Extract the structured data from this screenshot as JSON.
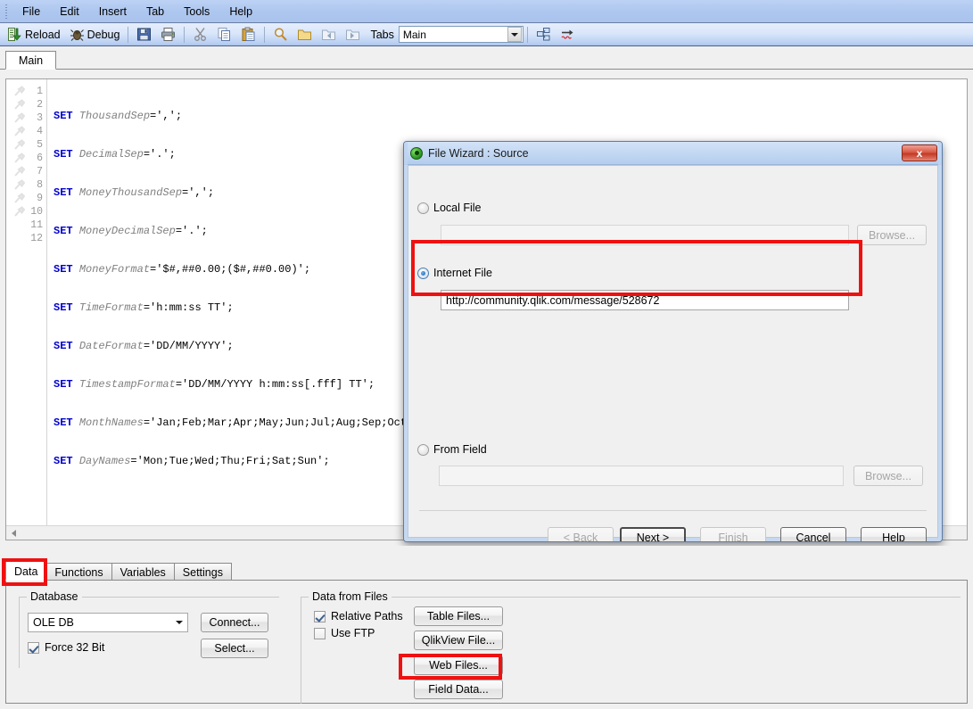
{
  "menubar": {
    "items": [
      "File",
      "Edit",
      "Insert",
      "Tab",
      "Tools",
      "Help"
    ]
  },
  "toolbar": {
    "reload_label": "Reload",
    "debug_label": "Debug",
    "tabs_label": "Tabs",
    "tabs_value": "Main",
    "icons": [
      "reload-icon",
      "debug-icon",
      "save-icon",
      "print-icon",
      "cut-icon",
      "copy-icon",
      "paste-icon",
      "find-icon",
      "open-folder-icon",
      "back-icon",
      "forward-icon",
      "table-viewer-icon",
      "syntax-check-icon"
    ]
  },
  "script_tabs": [
    {
      "label": "Main",
      "active": true
    }
  ],
  "editor": {
    "lines": [
      {
        "no": "1",
        "kw": "SET ",
        "var": "ThousandSep",
        "rest": "=',';"
      },
      {
        "no": "2",
        "kw": "SET ",
        "var": "DecimalSep",
        "rest": "='.';"
      },
      {
        "no": "3",
        "kw": "SET ",
        "var": "MoneyThousandSep",
        "rest": "=',';"
      },
      {
        "no": "4",
        "kw": "SET ",
        "var": "MoneyDecimalSep",
        "rest": "='.';"
      },
      {
        "no": "5",
        "kw": "SET ",
        "var": "MoneyFormat",
        "rest": "='$#,##0.00;($#,##0.00)';"
      },
      {
        "no": "6",
        "kw": "SET ",
        "var": "TimeFormat",
        "rest": "='h:mm:ss TT';"
      },
      {
        "no": "7",
        "kw": "SET ",
        "var": "DateFormat",
        "rest": "='DD/MM/YYYY';"
      },
      {
        "no": "8",
        "kw": "SET ",
        "var": "TimestampFormat",
        "rest": "='DD/MM/YYYY h:mm:ss[.fff] TT';"
      },
      {
        "no": "9",
        "kw": "SET ",
        "var": "MonthNames",
        "rest": "='Jan;Feb;Mar;Apr;May;Jun;Jul;Aug;Sep;Oct;"
      },
      {
        "no": "10",
        "kw": "SET ",
        "var": "DayNames",
        "rest": "='Mon;Tue;Wed;Thu;Fri;Sat;Sun';"
      },
      {
        "no": "11",
        "kw": "",
        "var": "",
        "rest": ""
      },
      {
        "no": "12",
        "kw": "",
        "var": "",
        "rest": ""
      }
    ]
  },
  "dialog": {
    "title": "File Wizard : Source",
    "close_label": "x",
    "local_file": {
      "label": "Local File",
      "selected": false,
      "value": "",
      "browse_label": "Browse..."
    },
    "internet_file": {
      "label": "Internet File",
      "selected": true,
      "value": "http://community.qlik.com/message/528672"
    },
    "from_field": {
      "label": "From Field",
      "selected": false,
      "value": "",
      "browse_label": "Browse..."
    },
    "buttons": {
      "back": "< Back",
      "next": "Next >",
      "finish": "Finish",
      "cancel": "Cancel",
      "help": "Help"
    }
  },
  "bottom": {
    "tabs": [
      {
        "label": "Data",
        "active": true
      },
      {
        "label": "Functions",
        "active": false
      },
      {
        "label": "Variables",
        "active": false
      },
      {
        "label": "Settings",
        "active": false
      }
    ],
    "database": {
      "title": "Database",
      "provider": "OLE DB",
      "connect_label": "Connect...",
      "select_label": "Select...",
      "force32_label": "Force 32 Bit",
      "force32_checked": true
    },
    "data_from_files": {
      "title": "Data from Files",
      "relative_paths_label": "Relative Paths",
      "relative_paths_checked": true,
      "use_ftp_label": "Use FTP",
      "use_ftp_checked": false,
      "buttons": [
        "Table Files...",
        "QlikView File...",
        "Web Files...",
        "Field Data..."
      ]
    }
  },
  "annotations": {
    "highlight_color": "#ee1111",
    "boxes": [
      "internet-file-highlight",
      "data-tab-highlight",
      "web-files-highlight"
    ]
  }
}
